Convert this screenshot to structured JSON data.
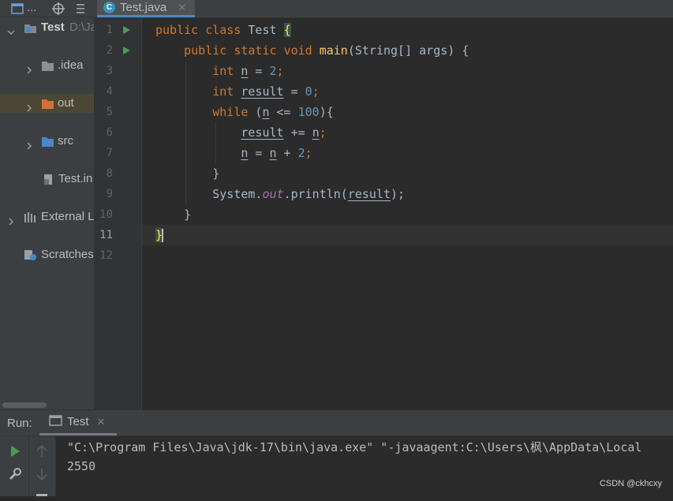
{
  "project_pane": {
    "items": [
      {
        "label": "Test",
        "extra": "D:\\Ja",
        "kind": "project",
        "expanded": true,
        "selected": false
      },
      {
        "label": ".idea",
        "kind": "folder",
        "expanded": false,
        "selected": false
      },
      {
        "label": "out",
        "kind": "folder-excluded",
        "expanded": false,
        "selected": true
      },
      {
        "label": "src",
        "kind": "folder-source",
        "expanded": false,
        "selected": false
      },
      {
        "label": "Test.in",
        "kind": "file",
        "selected": false
      },
      {
        "label": "External L",
        "kind": "libraries",
        "expanded": false,
        "selected": false
      },
      {
        "label": "Scratches",
        "kind": "scratches",
        "selected": false
      }
    ],
    "top_menu_label": "..."
  },
  "editor": {
    "tab": {
      "label": "Test.java",
      "icon": "java-class-icon"
    },
    "line_numbers": [
      "1",
      "2",
      "3",
      "4",
      "5",
      "6",
      "7",
      "8",
      "9",
      "10",
      "11",
      "12"
    ],
    "current_line": 11,
    "code": {
      "l1": [
        "public",
        "class",
        "Test",
        "{"
      ],
      "l2": [
        "public",
        "static",
        "void",
        "main",
        "(String[] args) {"
      ],
      "l3": [
        "int",
        "n",
        " = ",
        "2",
        ";"
      ],
      "l4": [
        "int",
        "result",
        " = ",
        "0",
        ";"
      ],
      "l5": [
        "while",
        " (",
        "n",
        " <= ",
        "100",
        "){"
      ],
      "l6": [
        "result",
        " += ",
        "n",
        ";"
      ],
      "l7": [
        "n",
        " = ",
        "n",
        " + ",
        "2",
        ";"
      ],
      "l8": [
        "}"
      ],
      "l9": [
        "System.",
        "out",
        ".println(",
        "result",
        ");"
      ],
      "l10": [
        "}"
      ],
      "l11": [
        "}"
      ]
    }
  },
  "run_panel": {
    "label": "Run:",
    "tab_label": "Test",
    "console": [
      "\"C:\\Program Files\\Java\\jdk-17\\bin\\java.exe\" \"-javaagent:C:\\Users\\枫\\AppData\\Local",
      "2550"
    ]
  },
  "watermark": "CSDN @ckhcxy",
  "colors": {
    "keyword": "#cc7832",
    "function": "#ffc66d",
    "number": "#6897bb",
    "field": "#9876aa",
    "run_green": "#499c54"
  }
}
